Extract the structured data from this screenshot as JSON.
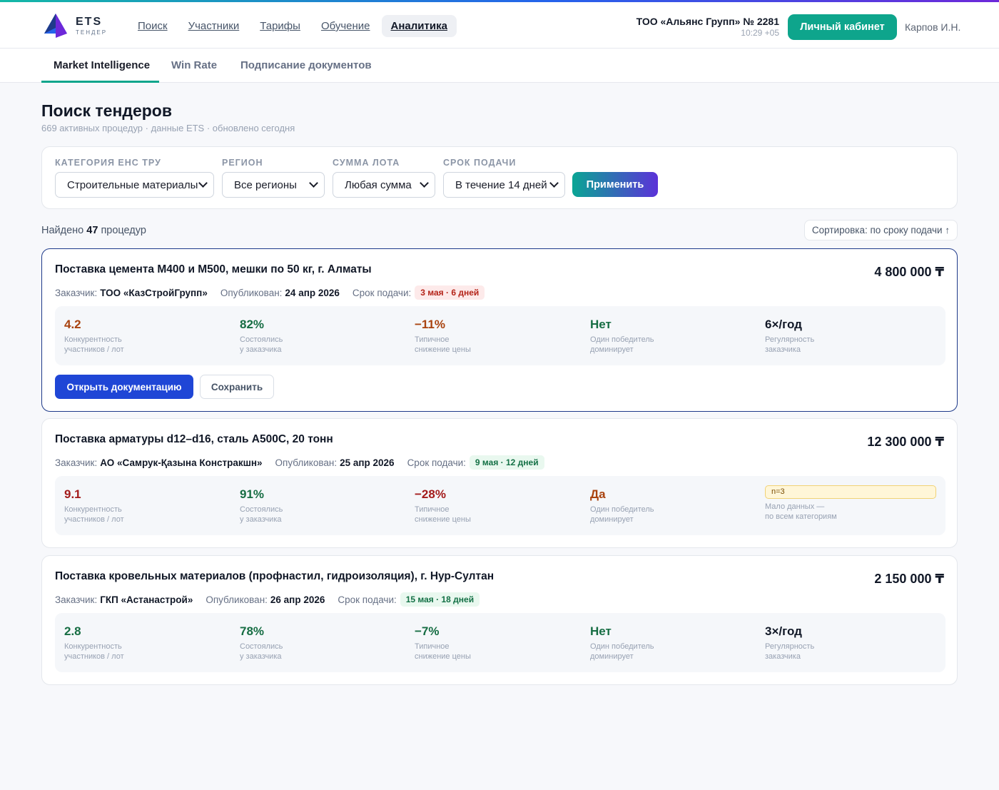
{
  "header": {
    "logo_main": "ETS",
    "logo_sub": "ТЕНДЕР",
    "nav": [
      "Поиск",
      "Участники",
      "Тарифы",
      "Обучение",
      "Аналитика"
    ],
    "nav_active": "Аналитика",
    "org_name": "ТОО «Альянс Групп» № 2281",
    "org_time": "10:29 +05",
    "cabinet_label": "Личный кабинет",
    "user": "Карпов И.Н."
  },
  "subnav": {
    "tabs": [
      "Market Intelligence",
      "Win Rate",
      "Подписание документов"
    ],
    "active": "Market Intelligence"
  },
  "page": {
    "title": "Поиск тендеров",
    "subtitle": "669 активных процедур · данные ETS · обновлено сегодня"
  },
  "filters": {
    "category": {
      "label": "Категория ЕНС ТРУ",
      "value": "Строительные материалы"
    },
    "region": {
      "label": "Регион",
      "value": "Все регионы"
    },
    "amount": {
      "label": "Сумма лота",
      "value": "Любая сумма"
    },
    "deadline": {
      "label": "Срок подачи",
      "value": "В течение 14 дней"
    },
    "apply_label": "Применить"
  },
  "results": {
    "found_prefix": "Найдено",
    "found_count": "47",
    "found_suffix": "процедур",
    "sort_label": "Сортировка: по сроку подачи ↑"
  },
  "labels": {
    "customer": "Заказчик:",
    "published": "Опубликован:",
    "deadline": "Срок подачи:",
    "competition": "Конкурентность\nучастников / лот",
    "held": "Состоялись\nу заказчика",
    "price_drop": "Типичное\nснижение цены",
    "dominant": "Один победитель\nдоминирует",
    "regularity": "Регулярность\nзаказчика",
    "low_data": "Мало данных —\nпо всем категориям",
    "open_docs": "Открыть документацию",
    "save": "Сохранить"
  },
  "tenders": [
    {
      "title": "Поставка цемента М400 и М500, мешки по 50 кг, г. Алматы",
      "price": "4 800 000 ₸",
      "customer": "ТОО «КазСтройГрупп»",
      "published": "24 апр 2026",
      "deadline": "3 мая · 6 дней",
      "deadline_tone": "red",
      "competition": "4.2",
      "held": "82%",
      "price_drop": "−11%",
      "dominant": "Нет",
      "regularity": "6×/год"
    },
    {
      "title": "Поставка арматуры d12–d16, сталь А500С, 20 тонн",
      "price": "12 300 000 ₸",
      "customer": "АО «Самрук-Қазына Констракшн»",
      "published": "25 апр 2026",
      "deadline": "9 мая · 12 дней",
      "deadline_tone": "green",
      "competition": "9.1",
      "held": "91%",
      "price_drop": "−28%",
      "dominant": "Да",
      "regularity_badge": "n=3"
    },
    {
      "title": "Поставка кровельных материалов (профнастил, гидроизоляция), г. Нур-Султан",
      "price": "2 150 000 ₸",
      "customer": "ГКП «Астанастрой»",
      "published": "26 апр 2026",
      "deadline": "15 мая · 18 дней",
      "deadline_tone": "green",
      "competition": "2.8",
      "held": "78%",
      "price_drop": "−7%",
      "dominant": "Нет",
      "regularity": "3×/год"
    }
  ],
  "colors": {
    "accent": "#0ea58c",
    "primary_button": "#1f46d6",
    "warning": "#a9430f",
    "good": "#166d43",
    "bad": "#a31b1b"
  }
}
